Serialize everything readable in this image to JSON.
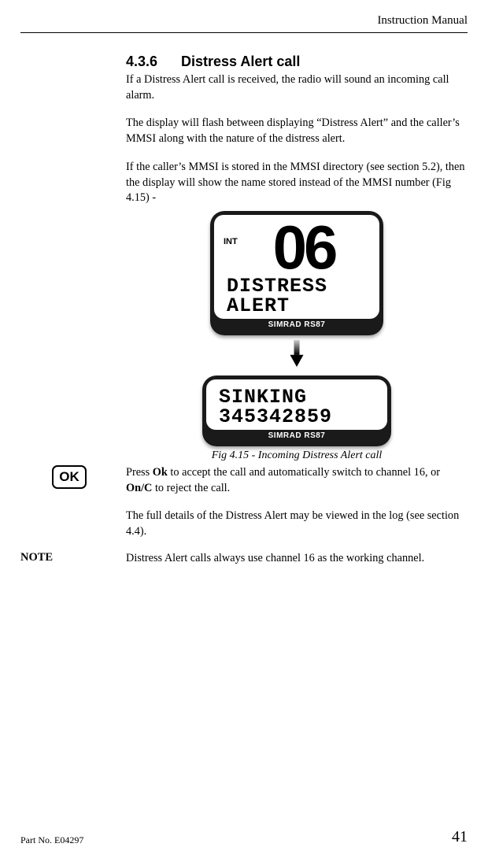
{
  "header": {
    "title": "Instruction Manual"
  },
  "section": {
    "number": "4.3.6",
    "title": "Distress Alert call"
  },
  "paras": {
    "p1": "If a Distress Alert call is received, the radio will sound an incoming call alarm.",
    "p2": "The display will flash between displaying  “Distress Alert” and the caller’s MMSI along with the nature of the distress alert.",
    "p3": "If the caller’s MMSI is stored in the MMSI directory (see section 5.2), then the display will show the name stored instead of the MMSI number (Fig 4.15) -"
  },
  "lcd1": {
    "int": "INT",
    "channel": "06",
    "line1": "DISTRESS",
    "line2": "ALERT",
    "product": "SIMRAD RS87"
  },
  "lcd2": {
    "line1": "SINKING",
    "line2": "345342859",
    "product": "SIMRAD RS87"
  },
  "fig_caption": "Fig 4.15 - Incoming Distress Alert call",
  "ok_label": "OK",
  "after_fig": {
    "p1a": "Press ",
    "p1b": "Ok",
    "p1c": " to accept the call and automatically switch to channel 16, or ",
    "p1d": "On/C",
    "p1e": " to reject the call.",
    "p2": "The full details of the Distress Alert may be viewed in the log (see section 4.4)."
  },
  "note": {
    "label": "NOTE",
    "text": "Distress Alert calls always use channel 16 as the working channel."
  },
  "footer": {
    "partno": "Part No. E04297",
    "page": "41"
  }
}
